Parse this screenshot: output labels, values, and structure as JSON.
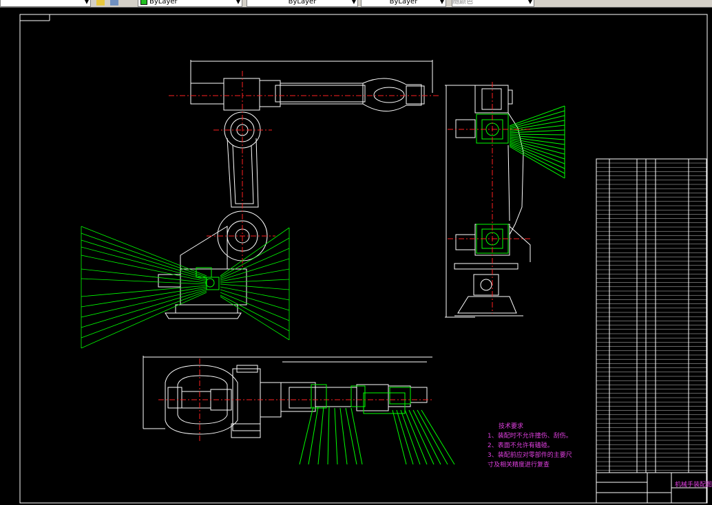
{
  "toolbar": {
    "layer_combo": "",
    "color_combo": "ByLayer",
    "linetype_combo": "ByLayer",
    "lineweight_combo": "ByLayer",
    "plotstyle_combo": "随颜色"
  },
  "drawing": {
    "tech_title": "技术要求",
    "tech_lines": [
      "1、装配时不允许撞伤、刮伤。",
      "2、表面不允许有磕碰。",
      "3、装配前应对零部件的主要尺",
      "寸及相关精度进行复查"
    ],
    "title_block_name": "机械手装配图"
  },
  "colors": {
    "background": "#000000",
    "geometry": "#ffffff",
    "leaders": "#00ff00",
    "centerlines": "#ff2020",
    "text": "#e040e0"
  }
}
